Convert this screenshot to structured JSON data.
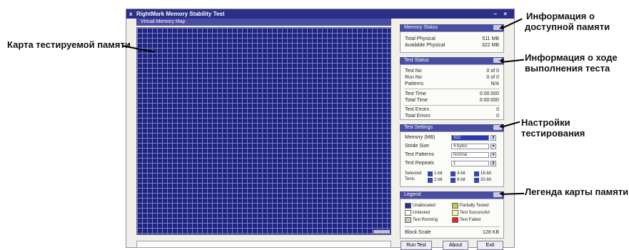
{
  "window": {
    "title": "RightMark Memory Stability Test",
    "min_symbol": "–",
    "close_symbol": "×",
    "app_icon": "x"
  },
  "map_panel": {
    "title": "Virtual Memory Map"
  },
  "memory_status": {
    "title": "Memory Status",
    "rows": [
      {
        "label": "Total Physical",
        "value": "511 MB"
      },
      {
        "label": "Available Physical",
        "value": "322 MB"
      }
    ]
  },
  "test_status": {
    "title": "Test Status",
    "rows_a": [
      {
        "label": "Test No",
        "value": "0 of 0"
      },
      {
        "label": "Run No",
        "value": "0 of 0"
      },
      {
        "label": "Patterns",
        "value": "N/A"
      }
    ],
    "rows_b": [
      {
        "label": "Test Time",
        "value": "0:00:000"
      },
      {
        "label": "Total Time",
        "value": "0:00:000"
      }
    ],
    "rows_c": [
      {
        "label": "Test Errors",
        "value": "0"
      },
      {
        "label": "Total Errors",
        "value": "0"
      }
    ]
  },
  "test_settings": {
    "title": "Test Settings",
    "memory_label": "Memory (MB)",
    "memory_value": "322",
    "stride_label": "Stride Size",
    "stride_value": "4 bytes",
    "patterns_label": "Test Patterns",
    "patterns_value": "Normal",
    "repeats_label": "Test Repeats",
    "repeats_value": "1",
    "selected_label_1": "Selected",
    "selected_label_2": "Tests",
    "checks": [
      "1-bit",
      "4-bit",
      "16-bit",
      "2-bit",
      "8-bit",
      "32-bit"
    ]
  },
  "legend": {
    "title": "Legend",
    "items": [
      {
        "label": "Unallocated",
        "color": "#2a3090"
      },
      {
        "label": "Partially Tested",
        "color": "#c8c25a"
      },
      {
        "label": "Untested",
        "color": "#ffffff"
      },
      {
        "label": "Test Successful",
        "color": "#ffff99"
      },
      {
        "label": "Test Running",
        "color": "#c9c9c9"
      },
      {
        "label": "Test Failed",
        "color": "#e0262a"
      }
    ],
    "block_scale_label": "Block Scale",
    "block_scale_value": "128 KB"
  },
  "buttons": {
    "run": "Run Test",
    "about": "About",
    "exit": "Exit"
  },
  "annotations": {
    "memory_map": "Карта тестируемой памяти",
    "mem_info_1": "Информация о",
    "mem_info_2": "доступной памяти",
    "progress_1": "Информация о ходе",
    "progress_2": "выполнения теста",
    "settings": "Настройки тестирования",
    "legend": "Легенда карты памяти"
  }
}
